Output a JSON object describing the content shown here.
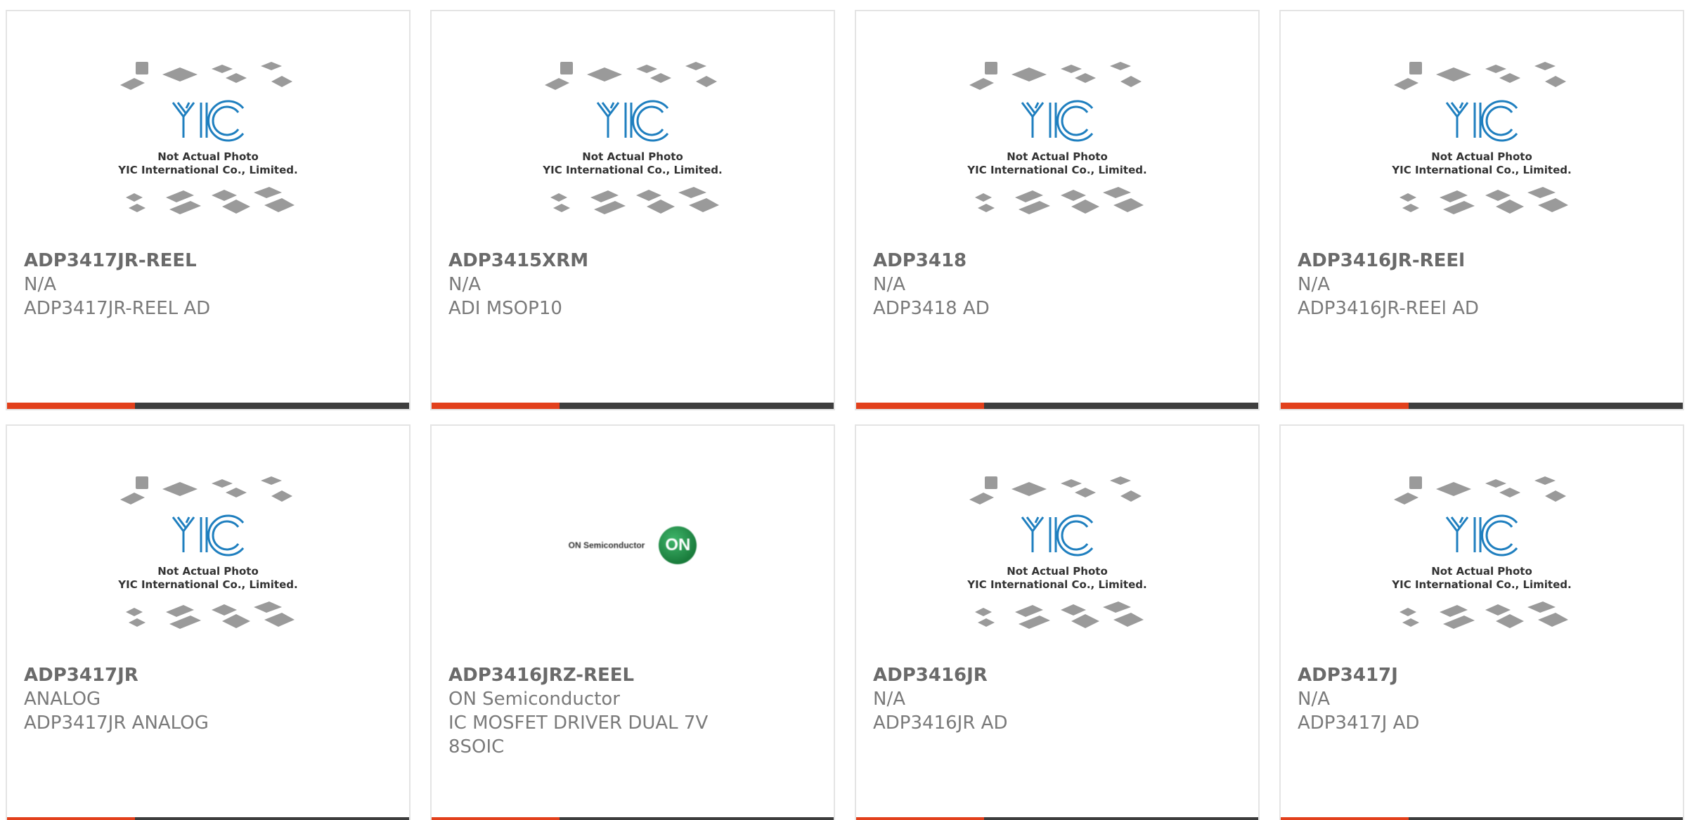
{
  "placeholder_caption": {
    "line1": "Not Actual Photo",
    "line2": "YIC International Co., Limited."
  },
  "colors": {
    "accent": "#e2401c",
    "bar": "#3d3d3d",
    "logo_blue": "#1f7fbf"
  },
  "products": [
    {
      "part": "ADP3417JR-REEL",
      "manufacturer": "N/A",
      "description": "ADP3417JR-REEL AD",
      "image": "yic-placeholder"
    },
    {
      "part": "ADP3415XRM",
      "manufacturer": "N/A",
      "description": "ADI MSOP10",
      "image": "yic-placeholder"
    },
    {
      "part": "ADP3418",
      "manufacturer": "N/A",
      "description": "ADP3418 AD",
      "image": "yic-placeholder"
    },
    {
      "part": "ADP3416JR-REEl",
      "manufacturer": "N/A",
      "description": "ADP3416JR-REEl AD",
      "image": "yic-placeholder"
    },
    {
      "part": "ADP3417JR",
      "manufacturer": "ANALOG",
      "description": "ADP3417JR ANALOG",
      "image": "yic-placeholder"
    },
    {
      "part": "ADP3416JRZ-REEL",
      "manufacturer": "ON Semiconductor",
      "description": "IC MOSFET DRIVER DUAL 7V 8SOIC",
      "image": "on-semi-logo"
    },
    {
      "part": "ADP3416JR",
      "manufacturer": "N/A",
      "description": "ADP3416JR AD",
      "image": "yic-placeholder"
    },
    {
      "part": "ADP3417J",
      "manufacturer": "N/A",
      "description": "ADP3417J AD",
      "image": "yic-placeholder"
    }
  ],
  "on_logo": {
    "wordmark": "ON Semiconductor",
    "badge": "ON"
  }
}
